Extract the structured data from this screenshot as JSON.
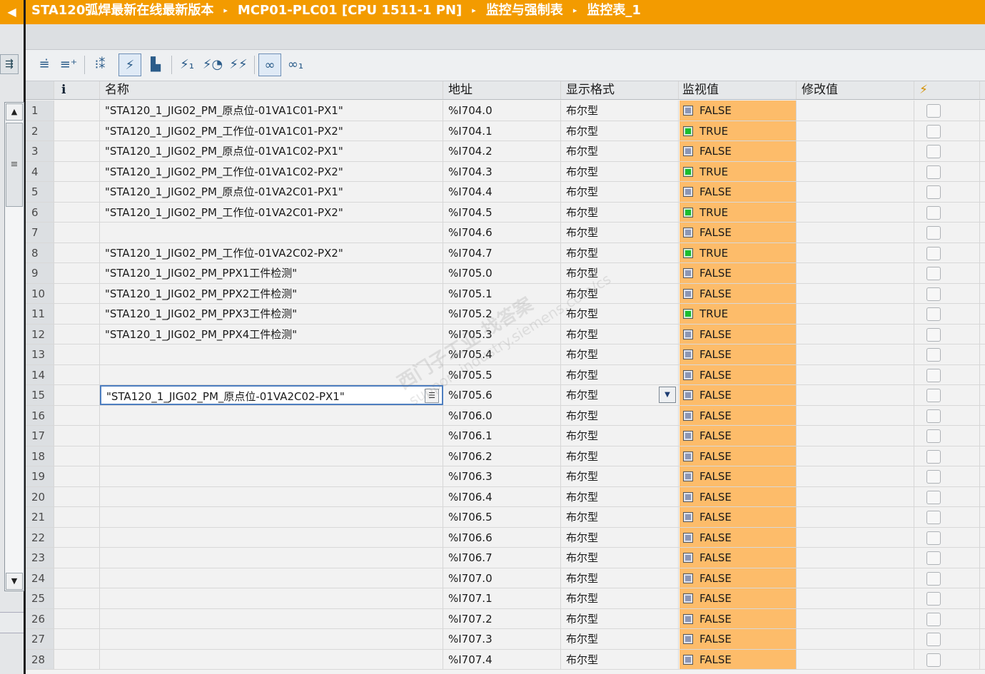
{
  "titlebar": {
    "crumbs": [
      "STA120弧焊最新在线最新版本",
      "MCP01-PLC01 [CPU 1511-1 PN]",
      "监控与强制表",
      "监控表_1"
    ],
    "sep": "▸"
  },
  "toolbar": {
    "icons": [
      "insert-row-icon",
      "add-row-icon",
      "update-icon",
      "monitor-once-icon",
      "trigger-icon",
      "modify-now-icon",
      "modify-trigger-icon",
      "force-icon",
      "monitor-all-icon",
      "monitor-now-icon"
    ]
  },
  "header": {
    "info": "i",
    "name": "名称",
    "address": "地址",
    "format": "显示格式",
    "monitor_value": "监视值",
    "modify_value": "修改值",
    "force": "⚡"
  },
  "rows": [
    {
      "num": "1",
      "name": "\"STA120_1_JIG02_PM_原点位-01VA1C01-PX1\"",
      "address": "%I704.0",
      "format": "布尔型",
      "value": "FALSE"
    },
    {
      "num": "2",
      "name": "\"STA120_1_JIG02_PM_工作位-01VA1C01-PX2\"",
      "address": "%I704.1",
      "format": "布尔型",
      "value": "TRUE"
    },
    {
      "num": "3",
      "name": "\"STA120_1_JIG02_PM_原点位-01VA1C02-PX1\"",
      "address": "%I704.2",
      "format": "布尔型",
      "value": "FALSE"
    },
    {
      "num": "4",
      "name": "\"STA120_1_JIG02_PM_工作位-01VA1C02-PX2\"",
      "address": "%I704.3",
      "format": "布尔型",
      "value": "TRUE"
    },
    {
      "num": "5",
      "name": "\"STA120_1_JIG02_PM_原点位-01VA2C01-PX1\"",
      "address": "%I704.4",
      "format": "布尔型",
      "value": "FALSE"
    },
    {
      "num": "6",
      "name": "\"STA120_1_JIG02_PM_工作位-01VA2C01-PX2\"",
      "address": "%I704.5",
      "format": "布尔型",
      "value": "TRUE"
    },
    {
      "num": "7",
      "name": "",
      "address": "%I704.6",
      "format": "布尔型",
      "value": "FALSE"
    },
    {
      "num": "8",
      "name": "\"STA120_1_JIG02_PM_工作位-01VA2C02-PX2\"",
      "address": "%I704.7",
      "format": "布尔型",
      "value": "TRUE"
    },
    {
      "num": "9",
      "name": "\"STA120_1_JIG02_PM_PPX1工件检测\"",
      "address": "%I705.0",
      "format": "布尔型",
      "value": "FALSE"
    },
    {
      "num": "10",
      "name": "\"STA120_1_JIG02_PM_PPX2工件检测\"",
      "address": "%I705.1",
      "format": "布尔型",
      "value": "FALSE"
    },
    {
      "num": "11",
      "name": "\"STA120_1_JIG02_PM_PPX3工件检测\"",
      "address": "%I705.2",
      "format": "布尔型",
      "value": "TRUE"
    },
    {
      "num": "12",
      "name": "\"STA120_1_JIG02_PM_PPX4工件检测\"",
      "address": "%I705.3",
      "format": "布尔型",
      "value": "FALSE"
    },
    {
      "num": "13",
      "name": "",
      "address": "%I705.4",
      "format": "布尔型",
      "value": "FALSE"
    },
    {
      "num": "14",
      "name": "",
      "address": "%I705.5",
      "format": "布尔型",
      "value": "FALSE"
    },
    {
      "num": "15",
      "name": "\"STA120_1_JIG02_PM_原点位-01VA2C02-PX1\"",
      "address": "%I705.6",
      "format": "布尔型",
      "value": "FALSE",
      "editing": true
    },
    {
      "num": "16",
      "name": "",
      "address": "%I706.0",
      "format": "布尔型",
      "value": "FALSE"
    },
    {
      "num": "17",
      "name": "",
      "address": "%I706.1",
      "format": "布尔型",
      "value": "FALSE"
    },
    {
      "num": "18",
      "name": "",
      "address": "%I706.2",
      "format": "布尔型",
      "value": "FALSE"
    },
    {
      "num": "19",
      "name": "",
      "address": "%I706.3",
      "format": "布尔型",
      "value": "FALSE"
    },
    {
      "num": "20",
      "name": "",
      "address": "%I706.4",
      "format": "布尔型",
      "value": "FALSE"
    },
    {
      "num": "21",
      "name": "",
      "address": "%I706.5",
      "format": "布尔型",
      "value": "FALSE"
    },
    {
      "num": "22",
      "name": "",
      "address": "%I706.6",
      "format": "布尔型",
      "value": "FALSE"
    },
    {
      "num": "23",
      "name": "",
      "address": "%I706.7",
      "format": "布尔型",
      "value": "FALSE"
    },
    {
      "num": "24",
      "name": "",
      "address": "%I707.0",
      "format": "布尔型",
      "value": "FALSE"
    },
    {
      "num": "25",
      "name": "",
      "address": "%I707.1",
      "format": "布尔型",
      "value": "FALSE"
    },
    {
      "num": "26",
      "name": "",
      "address": "%I707.2",
      "format": "布尔型",
      "value": "FALSE"
    },
    {
      "num": "27",
      "name": "",
      "address": "%I707.3",
      "format": "布尔型",
      "value": "FALSE"
    },
    {
      "num": "28",
      "name": "",
      "address": "%I707.4",
      "format": "布尔型",
      "value": "FALSE"
    }
  ],
  "watermark": {
    "line1": "西门子工业 找答案",
    "line2": "support.industry.siemens.com/cs"
  },
  "colors": {
    "accent": "#f39b00",
    "monitor_bg": "#fdbc6a",
    "true_led": "#1bbd2e",
    "false_led": "#8c96b4"
  }
}
